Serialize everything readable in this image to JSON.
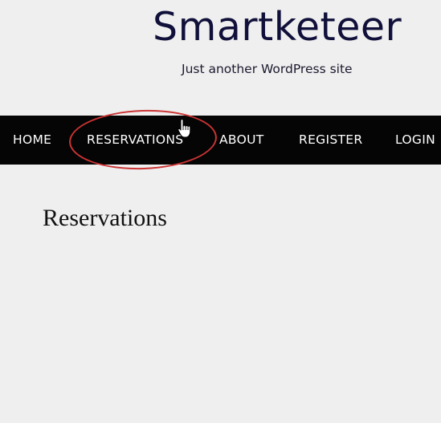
{
  "site": {
    "title": "Smartketeer",
    "tagline": "Just another WordPress site"
  },
  "nav": {
    "items": [
      {
        "label": "HOME"
      },
      {
        "label": "RESERVATIONS"
      },
      {
        "label": "ABOUT"
      },
      {
        "label": "REGISTER"
      },
      {
        "label": "LOGIN"
      }
    ],
    "highlighted_item": "RESERVATIONS"
  },
  "main": {
    "heading": "Reservations"
  },
  "annotation": {
    "ring_color": "#cc3333",
    "cursor_icon": "hand-pointer-icon"
  },
  "colors": {
    "background": "#efefef",
    "navbar": "#050505",
    "title": "#10103a"
  }
}
